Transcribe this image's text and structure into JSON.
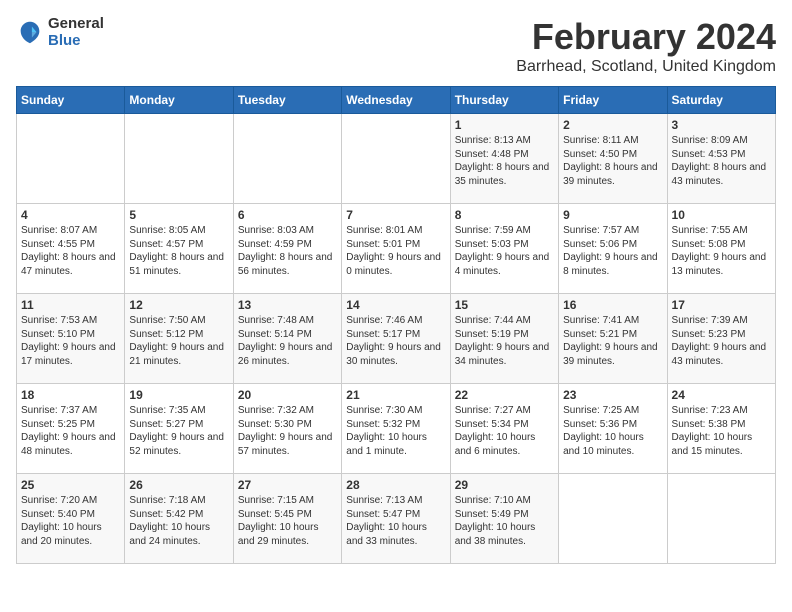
{
  "logo": {
    "general": "General",
    "blue": "Blue"
  },
  "title": "February 2024",
  "location": "Barrhead, Scotland, United Kingdom",
  "days_of_week": [
    "Sunday",
    "Monday",
    "Tuesday",
    "Wednesday",
    "Thursday",
    "Friday",
    "Saturday"
  ],
  "weeks": [
    [
      {
        "day": "",
        "sunrise": "",
        "sunset": "",
        "daylight": ""
      },
      {
        "day": "",
        "sunrise": "",
        "sunset": "",
        "daylight": ""
      },
      {
        "day": "",
        "sunrise": "",
        "sunset": "",
        "daylight": ""
      },
      {
        "day": "",
        "sunrise": "",
        "sunset": "",
        "daylight": ""
      },
      {
        "day": "1",
        "sunrise": "Sunrise: 8:13 AM",
        "sunset": "Sunset: 4:48 PM",
        "daylight": "Daylight: 8 hours and 35 minutes."
      },
      {
        "day": "2",
        "sunrise": "Sunrise: 8:11 AM",
        "sunset": "Sunset: 4:50 PM",
        "daylight": "Daylight: 8 hours and 39 minutes."
      },
      {
        "day": "3",
        "sunrise": "Sunrise: 8:09 AM",
        "sunset": "Sunset: 4:53 PM",
        "daylight": "Daylight: 8 hours and 43 minutes."
      }
    ],
    [
      {
        "day": "4",
        "sunrise": "Sunrise: 8:07 AM",
        "sunset": "Sunset: 4:55 PM",
        "daylight": "Daylight: 8 hours and 47 minutes."
      },
      {
        "day": "5",
        "sunrise": "Sunrise: 8:05 AM",
        "sunset": "Sunset: 4:57 PM",
        "daylight": "Daylight: 8 hours and 51 minutes."
      },
      {
        "day": "6",
        "sunrise": "Sunrise: 8:03 AM",
        "sunset": "Sunset: 4:59 PM",
        "daylight": "Daylight: 8 hours and 56 minutes."
      },
      {
        "day": "7",
        "sunrise": "Sunrise: 8:01 AM",
        "sunset": "Sunset: 5:01 PM",
        "daylight": "Daylight: 9 hours and 0 minutes."
      },
      {
        "day": "8",
        "sunrise": "Sunrise: 7:59 AM",
        "sunset": "Sunset: 5:03 PM",
        "daylight": "Daylight: 9 hours and 4 minutes."
      },
      {
        "day": "9",
        "sunrise": "Sunrise: 7:57 AM",
        "sunset": "Sunset: 5:06 PM",
        "daylight": "Daylight: 9 hours and 8 minutes."
      },
      {
        "day": "10",
        "sunrise": "Sunrise: 7:55 AM",
        "sunset": "Sunset: 5:08 PM",
        "daylight": "Daylight: 9 hours and 13 minutes."
      }
    ],
    [
      {
        "day": "11",
        "sunrise": "Sunrise: 7:53 AM",
        "sunset": "Sunset: 5:10 PM",
        "daylight": "Daylight: 9 hours and 17 minutes."
      },
      {
        "day": "12",
        "sunrise": "Sunrise: 7:50 AM",
        "sunset": "Sunset: 5:12 PM",
        "daylight": "Daylight: 9 hours and 21 minutes."
      },
      {
        "day": "13",
        "sunrise": "Sunrise: 7:48 AM",
        "sunset": "Sunset: 5:14 PM",
        "daylight": "Daylight: 9 hours and 26 minutes."
      },
      {
        "day": "14",
        "sunrise": "Sunrise: 7:46 AM",
        "sunset": "Sunset: 5:17 PM",
        "daylight": "Daylight: 9 hours and 30 minutes."
      },
      {
        "day": "15",
        "sunrise": "Sunrise: 7:44 AM",
        "sunset": "Sunset: 5:19 PM",
        "daylight": "Daylight: 9 hours and 34 minutes."
      },
      {
        "day": "16",
        "sunrise": "Sunrise: 7:41 AM",
        "sunset": "Sunset: 5:21 PM",
        "daylight": "Daylight: 9 hours and 39 minutes."
      },
      {
        "day": "17",
        "sunrise": "Sunrise: 7:39 AM",
        "sunset": "Sunset: 5:23 PM",
        "daylight": "Daylight: 9 hours and 43 minutes."
      }
    ],
    [
      {
        "day": "18",
        "sunrise": "Sunrise: 7:37 AM",
        "sunset": "Sunset: 5:25 PM",
        "daylight": "Daylight: 9 hours and 48 minutes."
      },
      {
        "day": "19",
        "sunrise": "Sunrise: 7:35 AM",
        "sunset": "Sunset: 5:27 PM",
        "daylight": "Daylight: 9 hours and 52 minutes."
      },
      {
        "day": "20",
        "sunrise": "Sunrise: 7:32 AM",
        "sunset": "Sunset: 5:30 PM",
        "daylight": "Daylight: 9 hours and 57 minutes."
      },
      {
        "day": "21",
        "sunrise": "Sunrise: 7:30 AM",
        "sunset": "Sunset: 5:32 PM",
        "daylight": "Daylight: 10 hours and 1 minute."
      },
      {
        "day": "22",
        "sunrise": "Sunrise: 7:27 AM",
        "sunset": "Sunset: 5:34 PM",
        "daylight": "Daylight: 10 hours and 6 minutes."
      },
      {
        "day": "23",
        "sunrise": "Sunrise: 7:25 AM",
        "sunset": "Sunset: 5:36 PM",
        "daylight": "Daylight: 10 hours and 10 minutes."
      },
      {
        "day": "24",
        "sunrise": "Sunrise: 7:23 AM",
        "sunset": "Sunset: 5:38 PM",
        "daylight": "Daylight: 10 hours and 15 minutes."
      }
    ],
    [
      {
        "day": "25",
        "sunrise": "Sunrise: 7:20 AM",
        "sunset": "Sunset: 5:40 PM",
        "daylight": "Daylight: 10 hours and 20 minutes."
      },
      {
        "day": "26",
        "sunrise": "Sunrise: 7:18 AM",
        "sunset": "Sunset: 5:42 PM",
        "daylight": "Daylight: 10 hours and 24 minutes."
      },
      {
        "day": "27",
        "sunrise": "Sunrise: 7:15 AM",
        "sunset": "Sunset: 5:45 PM",
        "daylight": "Daylight: 10 hours and 29 minutes."
      },
      {
        "day": "28",
        "sunrise": "Sunrise: 7:13 AM",
        "sunset": "Sunset: 5:47 PM",
        "daylight": "Daylight: 10 hours and 33 minutes."
      },
      {
        "day": "29",
        "sunrise": "Sunrise: 7:10 AM",
        "sunset": "Sunset: 5:49 PM",
        "daylight": "Daylight: 10 hours and 38 minutes."
      },
      {
        "day": "",
        "sunrise": "",
        "sunset": "",
        "daylight": ""
      },
      {
        "day": "",
        "sunrise": "",
        "sunset": "",
        "daylight": ""
      }
    ]
  ]
}
